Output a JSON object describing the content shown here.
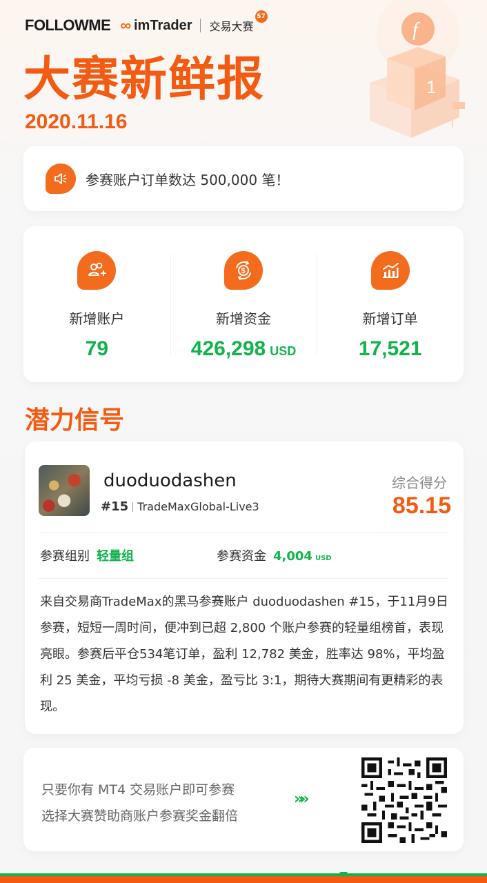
{
  "brand": {
    "followme": "FOLLOWME",
    "imtrader": "imTrader",
    "contest": "交易大赛",
    "season_badge": "S7"
  },
  "header": {
    "title": "大赛新鲜报",
    "date": "2020.11.16"
  },
  "notice": {
    "icon": "speaker-icon",
    "text": "参赛账户订单数达 500,000 笔！"
  },
  "stats": [
    {
      "icon": "add-users-icon",
      "label": "新增账户",
      "value": "79",
      "unit": ""
    },
    {
      "icon": "money-flow-icon",
      "label": "新增资金",
      "value": "426,298",
      "unit": "USD"
    },
    {
      "icon": "chart-icon",
      "label": "新增订单",
      "value": "17,521",
      "unit": ""
    }
  ],
  "section": {
    "title": "潜力信号"
  },
  "signal": {
    "name": "duoduodashen",
    "rank": "#15",
    "account": "TradeMaxGlobal-Live3",
    "score_label": "综合得分",
    "score": "85.15",
    "group_label": "参赛组别",
    "group_value": "轻量组",
    "fund_label": "参赛资金",
    "fund_value": "4,004",
    "fund_unit": "USD",
    "description": "来自交易商TradeMax的黑马参赛账户 duoduodashen #15，于11月9日参赛，短短一周时间，便冲到已超 2,800 个账户参赛的轻量组榜首，表现亮眼。参赛后平仓534笔订单，盈利 12,782 美金，胜率达 98%，平均盈利 25 美金，平均亏损 -8 美金，盈亏比 3:1，期待大赛期间有更精彩的表现。"
  },
  "footer": {
    "line1": "只要你有 MT4 交易账户即可参赛",
    "line2": "选择大赛赞助商账户参赛奖金翻倍",
    "arrows": "»»"
  },
  "colors": {
    "accent": "#f35a12",
    "green": "#12b34c"
  }
}
